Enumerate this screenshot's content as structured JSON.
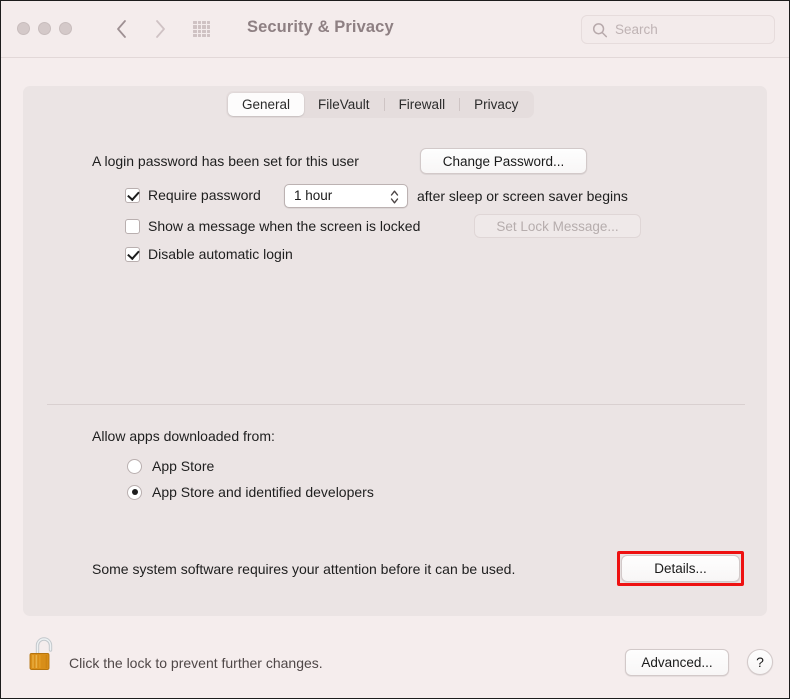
{
  "window": {
    "title": "Security & Privacy",
    "accent_highlight_color": "#EE1111"
  },
  "toolbar": {
    "grid_icon": "grid-icon",
    "back_icon": "chevron-left-icon",
    "forward_icon": "chevron-right-icon",
    "search": {
      "placeholder": "Search",
      "value": "",
      "icon": "search-icon"
    }
  },
  "tabs": [
    {
      "label": "General",
      "selected": true
    },
    {
      "label": "FileVault",
      "selected": false
    },
    {
      "label": "Firewall",
      "selected": false
    },
    {
      "label": "Privacy",
      "selected": false
    }
  ],
  "general": {
    "password_status": "A login password has been set for this user",
    "change_password_button": "Change Password...",
    "require_password": {
      "label": "Require password",
      "checked": true,
      "interval_value": "1 hour",
      "suffix": "after sleep or screen saver begins"
    },
    "show_message": {
      "label": "Show a message when the screen is locked",
      "checked": false,
      "button": "Set Lock Message...",
      "button_disabled": true
    },
    "disable_auto_login": {
      "label": "Disable automatic login",
      "checked": true
    },
    "allow_apps_heading": "Allow apps downloaded from:",
    "allow_apps_options": [
      {
        "label": "App Store",
        "selected": false
      },
      {
        "label": "App Store and identified developers",
        "selected": true
      }
    ],
    "attention_notice": "Some system software requires your attention before it can be used.",
    "details_button": "Details..."
  },
  "footer": {
    "lock_icon": "unlocked-padlock-icon",
    "lock_message": "Click the lock to prevent further changes.",
    "advanced_button": "Advanced...",
    "help_button": "?"
  }
}
